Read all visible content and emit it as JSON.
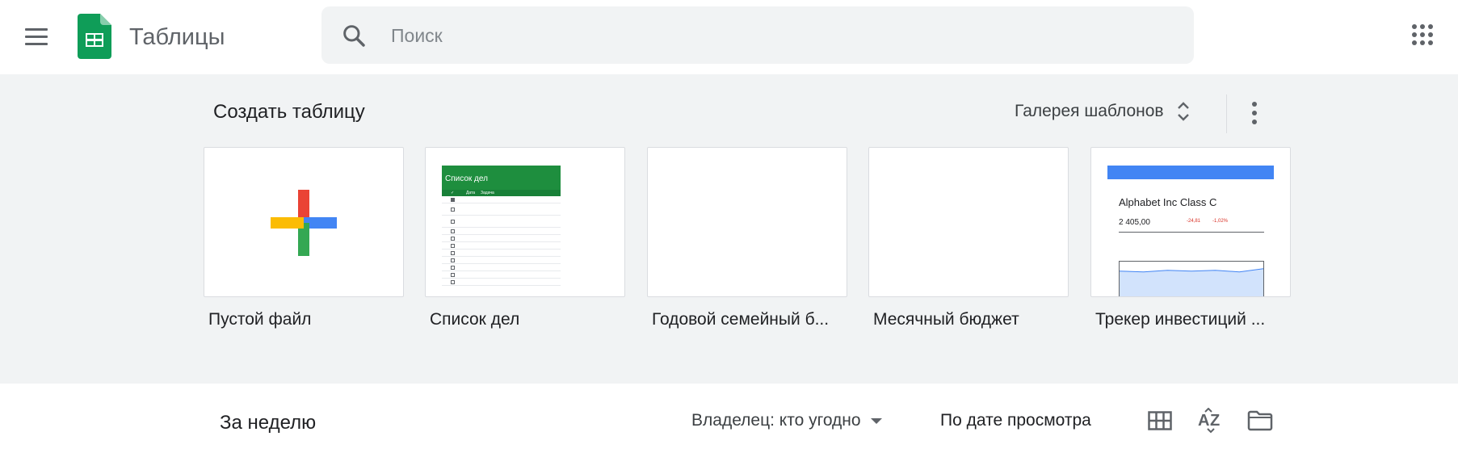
{
  "header": {
    "app_title": "Таблицы",
    "search_placeholder": "Поиск"
  },
  "gallery": {
    "title": "Создать таблицу",
    "gallery_button": "Галерея шаблонов",
    "templates": [
      {
        "label": "Пустой файл"
      },
      {
        "label": "Список дел"
      },
      {
        "label": "Годовой семейный б..."
      },
      {
        "label": "Месячный бюджет"
      },
      {
        "label": "Трекер инвестиций ..."
      }
    ],
    "todo_thumb": {
      "title": "Список дел",
      "date_col": "Дата",
      "task_col": "Задача"
    },
    "stock_thumb": {
      "title": "Alphabet Inc Class C",
      "price": "2 405,00",
      "change": "-24,81",
      "change_pct": "-1,02%"
    }
  },
  "recent": {
    "title": "За неделю",
    "owner_filter": "Владелец: кто угодно",
    "sort_label": "По дате просмотра"
  },
  "colors": {
    "sheets_green": "#0f9d58",
    "gallery_bg": "#f1f3f4",
    "google_red": "#ea4335",
    "google_blue": "#4285f4",
    "google_yellow": "#fbbc04",
    "google_green": "#34a853"
  },
  "icons": [
    "menu-icon",
    "sheets-logo-icon",
    "search-icon",
    "apps-grid-icon",
    "unfold-icon",
    "more-vert-icon",
    "plus-icon",
    "dropdown-caret-icon",
    "grid-view-icon",
    "sort-az-icon",
    "folder-icon"
  ]
}
